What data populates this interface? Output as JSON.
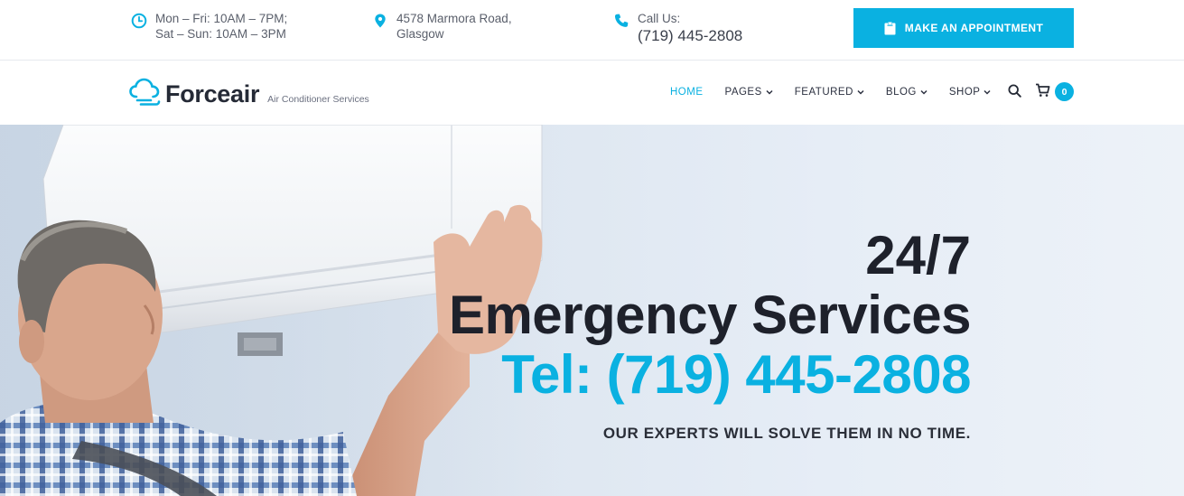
{
  "topbar": {
    "hours": {
      "line1": "Mon – Fri: 10AM – 7PM;",
      "line2": "Sat – Sun: 10AM – 3PM",
      "icon": "clock-icon"
    },
    "address": {
      "line1": "4578 Marmora Road,",
      "line2": "Glasgow",
      "icon": "map-pin-icon"
    },
    "phone": {
      "label": "Call Us:",
      "number": "(719) 445-2808",
      "icon": "phone-icon"
    },
    "appointment_button": "MAKE AN APPOINTMENT"
  },
  "nav": {
    "logo_name": "Forceair",
    "logo_tagline": "Air Conditioner Services",
    "items": [
      {
        "label": "HOME",
        "active": true,
        "dropdown": false
      },
      {
        "label": "PAGES",
        "active": false,
        "dropdown": true
      },
      {
        "label": "FEATURED",
        "active": false,
        "dropdown": true
      },
      {
        "label": "BLOG",
        "active": false,
        "dropdown": true
      },
      {
        "label": "SHOP",
        "active": false,
        "dropdown": true
      }
    ],
    "cart_count": "0"
  },
  "hero": {
    "line1": "24/7",
    "line2": "Emergency Services",
    "line3": "Tel: (719) 445-2808",
    "subtitle": "OUR EXPERTS WILL SOLVE THEM IN NO TIME."
  },
  "colors": {
    "accent": "#0ab1e1",
    "dark": "#1e212b"
  }
}
